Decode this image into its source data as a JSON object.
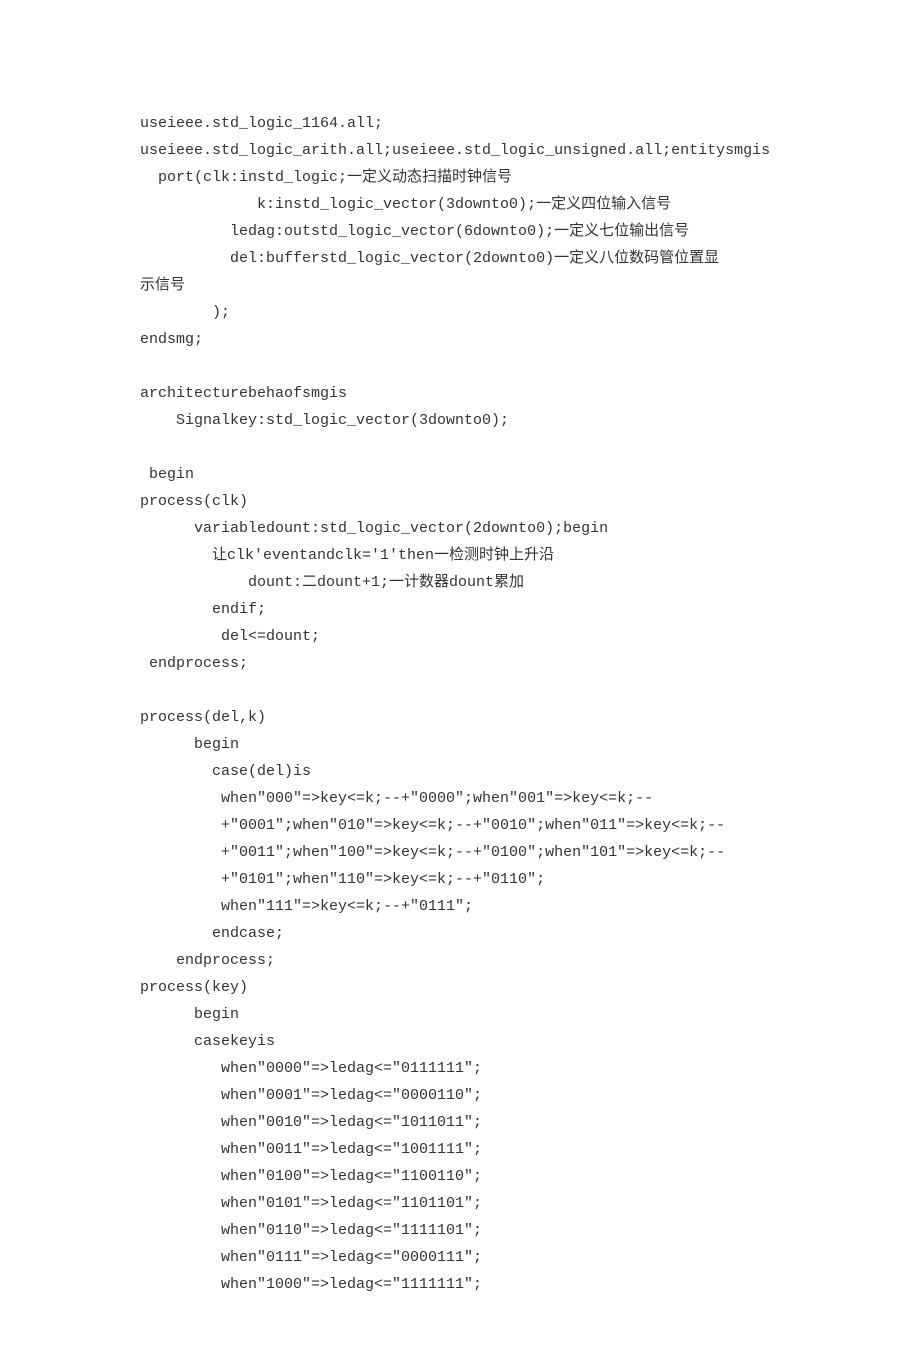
{
  "lines": [
    "useieee.std_logic_1164.all;",
    "useieee.std_logic_arith.all;useieee.std_logic_unsigned.all;entitysmgis",
    "  port(clk:instd_logic;一定义动态扫描时钟信号",
    "             k:instd_logic_vector(3downto0);一定义四位输入信号",
    "          ledag:outstd_logic_vector(6downto0);一定义七位输出信号",
    "          del:bufferstd_logic_vector(2downto0)一定义八位数码管位置显",
    "示信号",
    "        );",
    "endsmg;",
    "",
    "architecturebehaofsmgis",
    "    Signalkey:std_logic_vector(3downto0);",
    "",
    " begin",
    "process(clk)",
    "      variabledount:std_logic_vector(2downto0);begin",
    "        让clk'eventandclk='1'then一检测时钟上升沿",
    "            dount:二dount+1;一计数器dount累加",
    "        endif;",
    "         del<=dount;",
    " endprocess;",
    "",
    "process(del,k)",
    "      begin",
    "        case(del)is",
    "         when\"000\"=>key<=k;--+\"0000\";when\"001\"=>key<=k;--",
    "         +\"0001\";when\"010\"=>key<=k;--+\"0010\";when\"011\"=>key<=k;--",
    "         +\"0011\";when\"100\"=>key<=k;--+\"0100\";when\"101\"=>key<=k;--",
    "         +\"0101\";when\"110\"=>key<=k;--+\"0110\";",
    "         when\"111\"=>key<=k;--+\"0111\";",
    "        endcase;",
    "    endprocess;",
    "process(key)",
    "      begin",
    "      casekeyis",
    "         when\"0000\"=>ledag<=\"0111111\";",
    "         when\"0001\"=>ledag<=\"0000110\";",
    "         when\"0010\"=>ledag<=\"1011011\";",
    "         when\"0011\"=>ledag<=\"1001111\";",
    "         when\"0100\"=>ledag<=\"1100110\";",
    "         when\"0101\"=>ledag<=\"1101101\";",
    "         when\"0110\"=>ledag<=\"1111101\";",
    "         when\"0111\"=>ledag<=\"0000111\";",
    "         when\"1000\"=>ledag<=\"1111111\";"
  ]
}
